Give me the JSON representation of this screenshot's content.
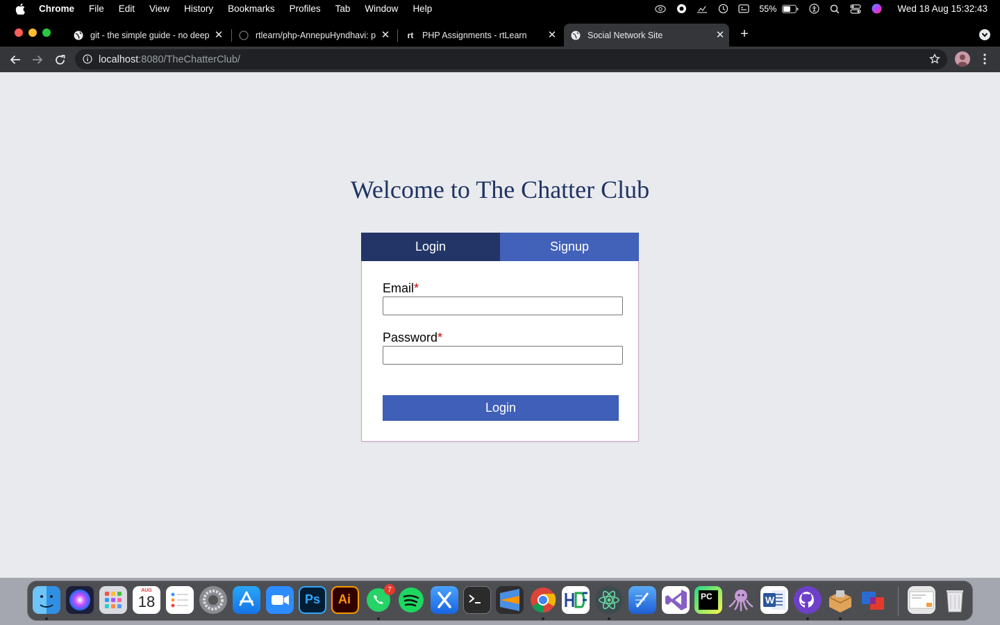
{
  "menubar": {
    "app_name": "Chrome",
    "items": [
      "File",
      "Edit",
      "View",
      "History",
      "Bookmarks",
      "Profiles",
      "Tab",
      "Window",
      "Help"
    ],
    "battery": "55%",
    "clock": "Wed 18 Aug  15:32:43"
  },
  "browser": {
    "tabs": [
      {
        "title": "git - the simple guide - no deep",
        "favicon": "globe-icon"
      },
      {
        "title": "rtlearn/php-AnnepuHyndhavi: p",
        "favicon": "github-icon"
      },
      {
        "title": "PHP Assignments - rtLearn",
        "favicon": "rt-icon",
        "favicon_text": "rt"
      },
      {
        "title": "Social Network Site",
        "favicon": "globe-icon",
        "active": true
      }
    ],
    "url_host": "localhost",
    "url_rest": ":8080/TheChatterClub/"
  },
  "page": {
    "heading": "Welcome to The Chatter Club",
    "tabs": {
      "login": "Login",
      "signup": "Signup"
    },
    "form": {
      "email_label": "Email",
      "password_label": "Password",
      "required_mark": "*",
      "submit_label": "Login",
      "email_value": "",
      "password_value": ""
    },
    "colors": {
      "heading": "#1f3363",
      "active_tab": "#223566",
      "inactive_tab": "#4261b9",
      "button": "#3f5fb8"
    }
  },
  "dock": {
    "calendar_month": "AUG",
    "calendar_day": "18",
    "whatsapp_badge": "7",
    "labels": {
      "photoshop": "Ps",
      "illustrator": "Ai",
      "word": "W",
      "pycharm": "PC"
    },
    "apps": [
      "finder",
      "siri",
      "launchpad",
      "calendar",
      "reminders",
      "system-preferences",
      "app-store",
      "zoom",
      "photoshop",
      "illustrator",
      "whatsapp",
      "spotify",
      "xcode",
      "terminal",
      "sublime-text",
      "chrome",
      "hdf",
      "atom",
      "xcode-instruments",
      "visual-studio",
      "pycharm",
      "gitkraken",
      "word",
      "github-desktop",
      "archive",
      "parallels",
      "downloads",
      "trash"
    ]
  }
}
